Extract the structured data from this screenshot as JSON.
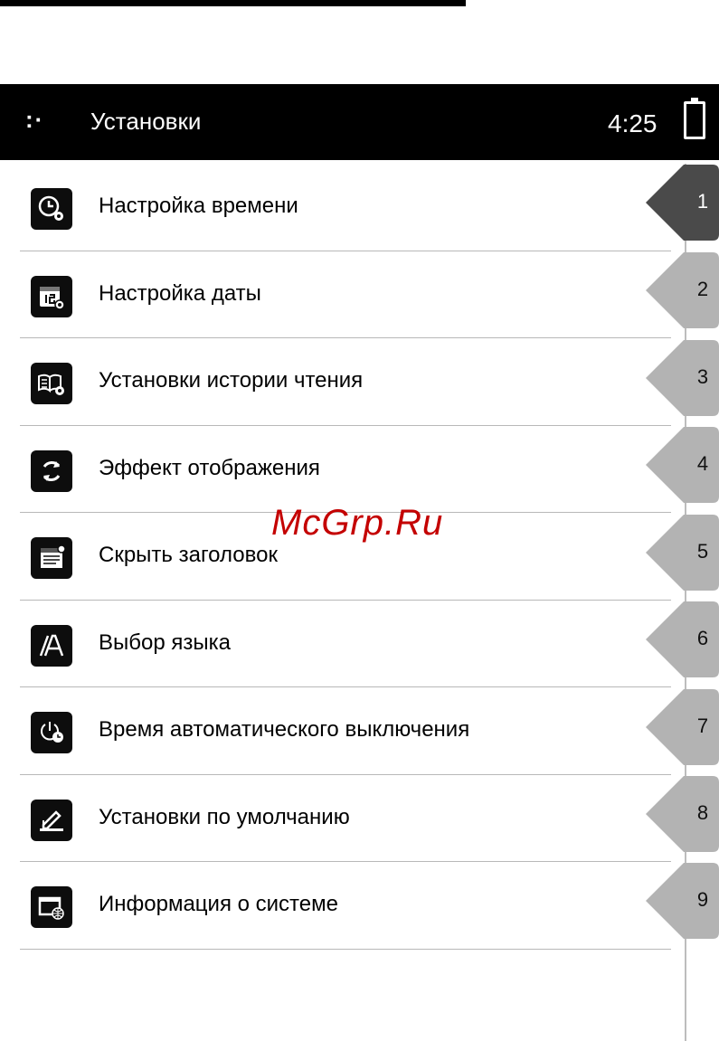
{
  "status_bar": {
    "menu_symbol": ":·",
    "title": "Установки",
    "clock": "4:25"
  },
  "menu_items": [
    {
      "label": "Настройка времени",
      "icon": "clock-gear-icon",
      "index": "1",
      "selected": true
    },
    {
      "label": "Настройка даты",
      "icon": "calendar-gear-icon",
      "index": "2"
    },
    {
      "label": "Установки истории чтения",
      "icon": "book-gear-icon",
      "index": "3"
    },
    {
      "label": "Эффект отображения",
      "icon": "refresh-icon",
      "index": "4"
    },
    {
      "label": "Скрыть заголовок",
      "icon": "hide-header-icon",
      "index": "5"
    },
    {
      "label": "Выбор языка",
      "icon": "language-icon",
      "index": "6"
    },
    {
      "label": "Время автоматического выключения",
      "icon": "auto-power-off-icon",
      "index": "7"
    },
    {
      "label": "Установки по умолчанию",
      "icon": "defaults-icon",
      "index": "8"
    },
    {
      "label": "Информация о системе",
      "icon": "system-info-icon",
      "index": "9"
    }
  ],
  "watermark": "McGrp.Ru",
  "colors": {
    "active_tab": "#4a4a4a",
    "inactive_tab": "#b3b3b3",
    "watermark": "#c40000"
  }
}
